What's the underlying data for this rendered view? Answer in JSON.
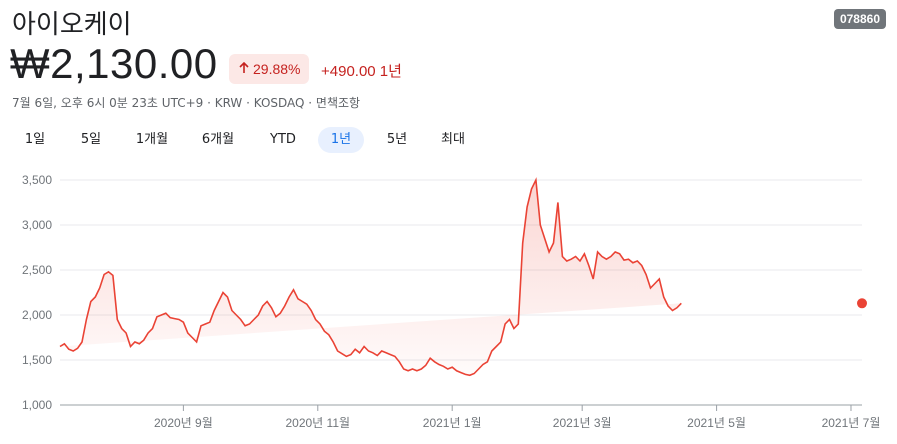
{
  "header": {
    "company_name": "아이오케이",
    "ticker": "078860",
    "price": "₩2,130.00",
    "change_percent": "29.88%",
    "change_arrow_icon": "arrow-up-icon",
    "change_absolute": "+490.00 1년",
    "meta": "7월 6일, 오후 6시 0분 23초 UTC+9 · KRW · KOSDAQ · 면책조항"
  },
  "tabs": [
    {
      "label": "1일"
    },
    {
      "label": "5일"
    },
    {
      "label": "1개월"
    },
    {
      "label": "6개월"
    },
    {
      "label": "YTD"
    },
    {
      "label": "1년"
    },
    {
      "label": "5년"
    },
    {
      "label": "최대"
    }
  ],
  "active_tab": "1년",
  "colors": {
    "line": "#ea4335",
    "active_tab": "#1a73e8",
    "down": "#c5221f"
  },
  "chart_data": {
    "type": "area",
    "y_ticks": [
      "3,500",
      "3,000",
      "2,500",
      "2,000",
      "1,500",
      "1,000"
    ],
    "ylim": [
      1000,
      3500
    ],
    "x_tick_labels": [
      "2020년 9월",
      "2020년 11월",
      "2021년 1월",
      "2021년 3월",
      "2021년 5월",
      "2021년 7월"
    ],
    "x_ticks_day": [
      56,
      117,
      178,
      237,
      298,
      359
    ],
    "xlim_day": [
      0,
      364
    ],
    "grid": true,
    "series": [
      {
        "x_day": [
          0,
          2,
          4,
          6,
          8,
          10,
          12,
          14,
          16,
          18,
          20,
          22,
          24,
          26,
          28,
          30,
          32,
          34,
          36,
          38,
          40,
          42,
          44,
          46,
          48,
          50,
          52,
          54,
          56,
          58,
          60,
          62,
          64,
          66,
          68,
          70,
          72,
          74,
          76,
          78,
          80,
          82,
          84,
          86,
          88,
          90,
          92,
          94,
          96,
          98,
          100,
          102,
          104,
          106,
          108,
          110,
          112,
          114,
          116,
          118,
          120,
          122,
          124,
          126,
          128,
          130,
          132,
          134,
          136,
          138,
          140,
          142,
          144,
          146,
          148,
          150,
          152,
          154,
          156,
          158,
          160,
          162,
          164,
          166,
          168,
          170,
          172,
          174,
          176,
          178,
          180,
          182,
          184,
          186,
          188,
          190,
          192,
          194,
          196,
          198,
          200,
          202,
          204,
          206,
          208,
          210,
          212,
          214,
          216,
          218,
          220,
          222,
          224,
          226,
          228,
          230,
          232,
          234,
          236,
          238,
          240,
          242,
          244,
          246,
          248,
          250,
          252,
          254,
          256,
          258,
          260,
          262,
          264,
          266,
          268,
          270,
          272,
          274,
          276,
          278,
          280,
          282,
          284,
          286,
          288,
          290,
          292,
          294,
          296,
          298,
          300,
          302,
          304,
          306,
          308,
          310,
          312,
          314,
          316,
          318,
          320,
          322,
          324,
          326,
          328,
          330,
          332,
          334,
          336,
          338,
          340,
          342,
          344,
          346,
          348,
          350,
          352,
          354,
          356,
          358,
          360,
          362,
          364
        ],
        "values": [
          1650,
          1680,
          1620,
          1600,
          1630,
          1700,
          1950,
          2150,
          2200,
          2300,
          2450,
          2480,
          2440,
          1950,
          1850,
          1800,
          1650,
          1700,
          1680,
          1720,
          1800,
          1850,
          1980,
          2000,
          2020,
          1970,
          1960,
          1950,
          1920,
          1800,
          1750,
          1700,
          1880,
          1900,
          1920,
          2050,
          2150,
          2250,
          2200,
          2050,
          2000,
          1950,
          1880,
          1900,
          1950,
          2000,
          2100,
          2150,
          2080,
          1980,
          2020,
          2100,
          2200,
          2280,
          2180,
          2150,
          2120,
          2050,
          1950,
          1900,
          1820,
          1780,
          1700,
          1600,
          1570,
          1540,
          1560,
          1620,
          1580,
          1650,
          1600,
          1580,
          1550,
          1600,
          1580,
          1560,
          1540,
          1480,
          1400,
          1380,
          1400,
          1380,
          1400,
          1440,
          1520,
          1480,
          1450,
          1430,
          1400,
          1420,
          1380,
          1360,
          1340,
          1330,
          1350,
          1400,
          1450,
          1480,
          1600,
          1650,
          1700,
          1900,
          1950,
          1850,
          1900,
          2800,
          3200,
          3400,
          3500,
          3000,
          2850,
          2700,
          2800,
          3250,
          2650,
          2600,
          2620,
          2650,
          2600,
          2680,
          2550,
          2400,
          2700,
          2650,
          2620,
          2650,
          2700,
          2680,
          2610,
          2620,
          2580,
          2600,
          2550,
          2450,
          2300,
          2350,
          2400,
          2200,
          2100,
          2050,
          2080,
          2130
        ]
      }
    ]
  }
}
